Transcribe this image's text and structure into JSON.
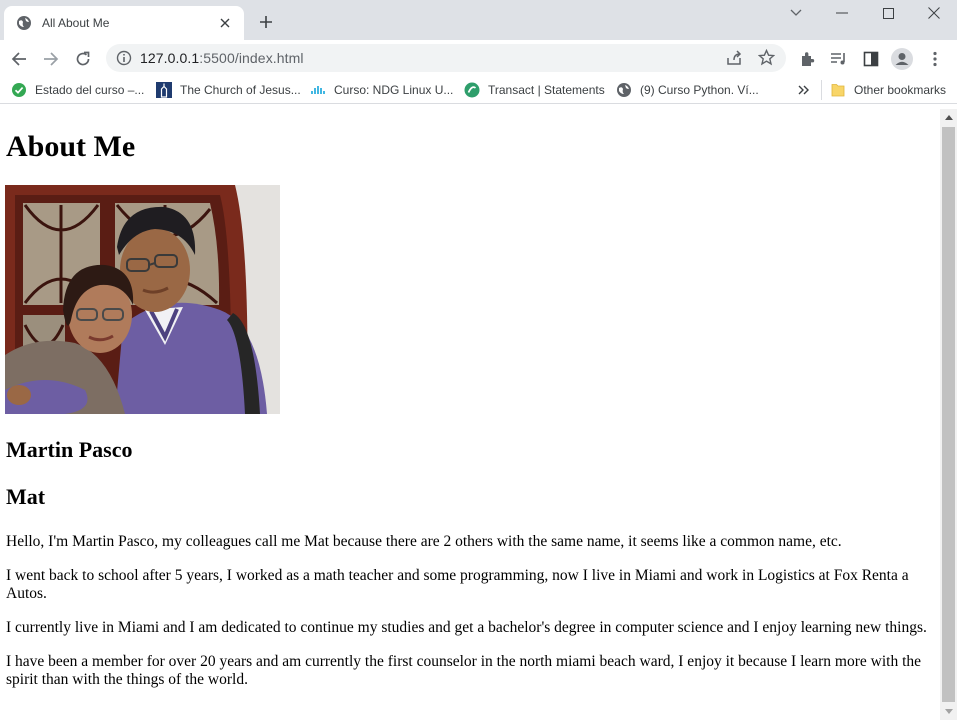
{
  "browser": {
    "tab": {
      "title": "All About Me",
      "favicon": "globe-icon"
    },
    "url": {
      "host": "127.0.0.1",
      "rest": ":5500/index.html"
    },
    "bookmarks": [
      {
        "label": "Estado del curso –...",
        "icon": "check-badge-icon",
        "color": "#34a853"
      },
      {
        "label": "The Church of Jesus...",
        "icon": "temple-icon",
        "color": "#1f3b6f"
      },
      {
        "label": "Curso: NDG Linux U...",
        "icon": "cisco-icon",
        "color": "#049fd9"
      },
      {
        "label": "Transact | Statements",
        "icon": "transact-icon",
        "color": "#2e9e6b"
      },
      {
        "label": "(9) Curso Python. Ví...",
        "icon": "globe-icon",
        "color": "#5f6368"
      }
    ],
    "other_bookmarks": "Other bookmarks"
  },
  "page": {
    "heading": "About Me",
    "photo_alt": "Photo of Martin Pasco",
    "name": "Martin Pasco",
    "nickname": "Mat",
    "paragraphs": [
      "Hello, I'm Martin Pasco, my colleagues call me Mat because there are 2 others with the same name, it seems like a common name, etc.",
      "I went back to school after 5 years, I worked as a math teacher and some programming, now I live in Miami and work in Logistics at Fox Renta a Autos.",
      "I currently live in Miami and I am dedicated to continue my studies and get a bachelor's degree in computer science and I enjoy learning new things.",
      "I have been a member for over 20 years and am currently the first counselor in the north miami beach ward, I enjoy it because I learn more with the spirit than with the things of the world."
    ]
  },
  "colors": {
    "tabstrip": "#dee1e6",
    "omnibox": "#f1f3f4",
    "scrollbar_thumb": "#c1c1c1"
  }
}
